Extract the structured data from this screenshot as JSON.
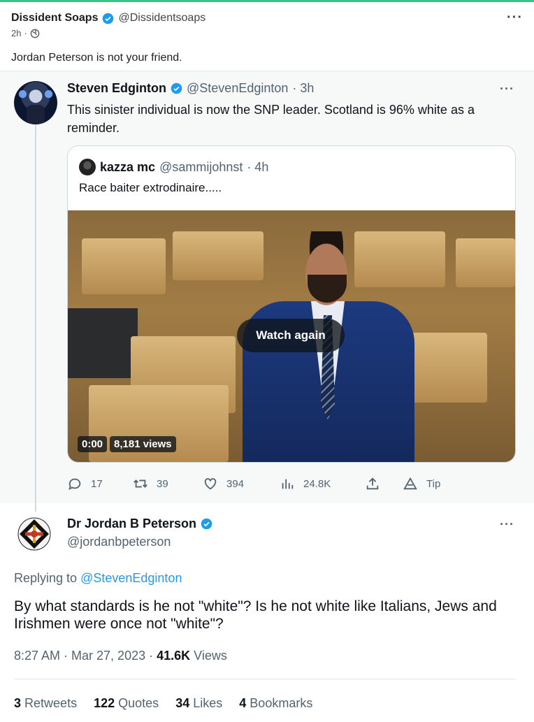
{
  "post": {
    "author": "Dissident Soaps",
    "handle": "@Dissidentsoaps",
    "time": "2h",
    "dot": "·",
    "body": "Jordan Peterson is not your friend.",
    "menu": "···"
  },
  "tweet": {
    "name": "Steven Edginton",
    "handle": "@StevenEdginton",
    "time": "· 3h",
    "text": "This sinister individual is now the SNP leader. Scotland is 96% white as a reminder.",
    "menu": "···",
    "quote": {
      "name": "kazza mc",
      "handle": "@sammijohnst",
      "time": "· 4h",
      "text": "Race baiter extrodinaire.....",
      "video": {
        "watch_again": "Watch again",
        "timestamp": "0:00",
        "views": "8,181 views"
      }
    },
    "actions": {
      "replies": "17",
      "retweets": "39",
      "likes": "394",
      "views": "24.8K",
      "tip": "Tip"
    }
  },
  "reply": {
    "name": "Dr Jordan B Peterson",
    "handle": "@jordanbpeterson",
    "menu": "···",
    "replying_prefix": "Replying to",
    "replying_to": "@StevenEdginton",
    "text": "By what standards is he not \"white\"? Is he not white like Italians, Jews and Irishmen were once not \"white\"?",
    "timestamp": "8:27 AM · Mar 27, 2023 · ",
    "view_count": "41.6K",
    "views_label": " Views",
    "stats": {
      "retweets_count": "3",
      "retweets_label": "Retweets",
      "quotes_count": "122",
      "quotes_label": "Quotes",
      "likes_count": "34",
      "likes_label": "Likes",
      "bookmarks_count": "4",
      "bookmarks_label": "Bookmarks"
    }
  },
  "colors": {
    "accent": "#1d9bf0",
    "top_bar": "#36c48a",
    "muted": "#536471"
  }
}
